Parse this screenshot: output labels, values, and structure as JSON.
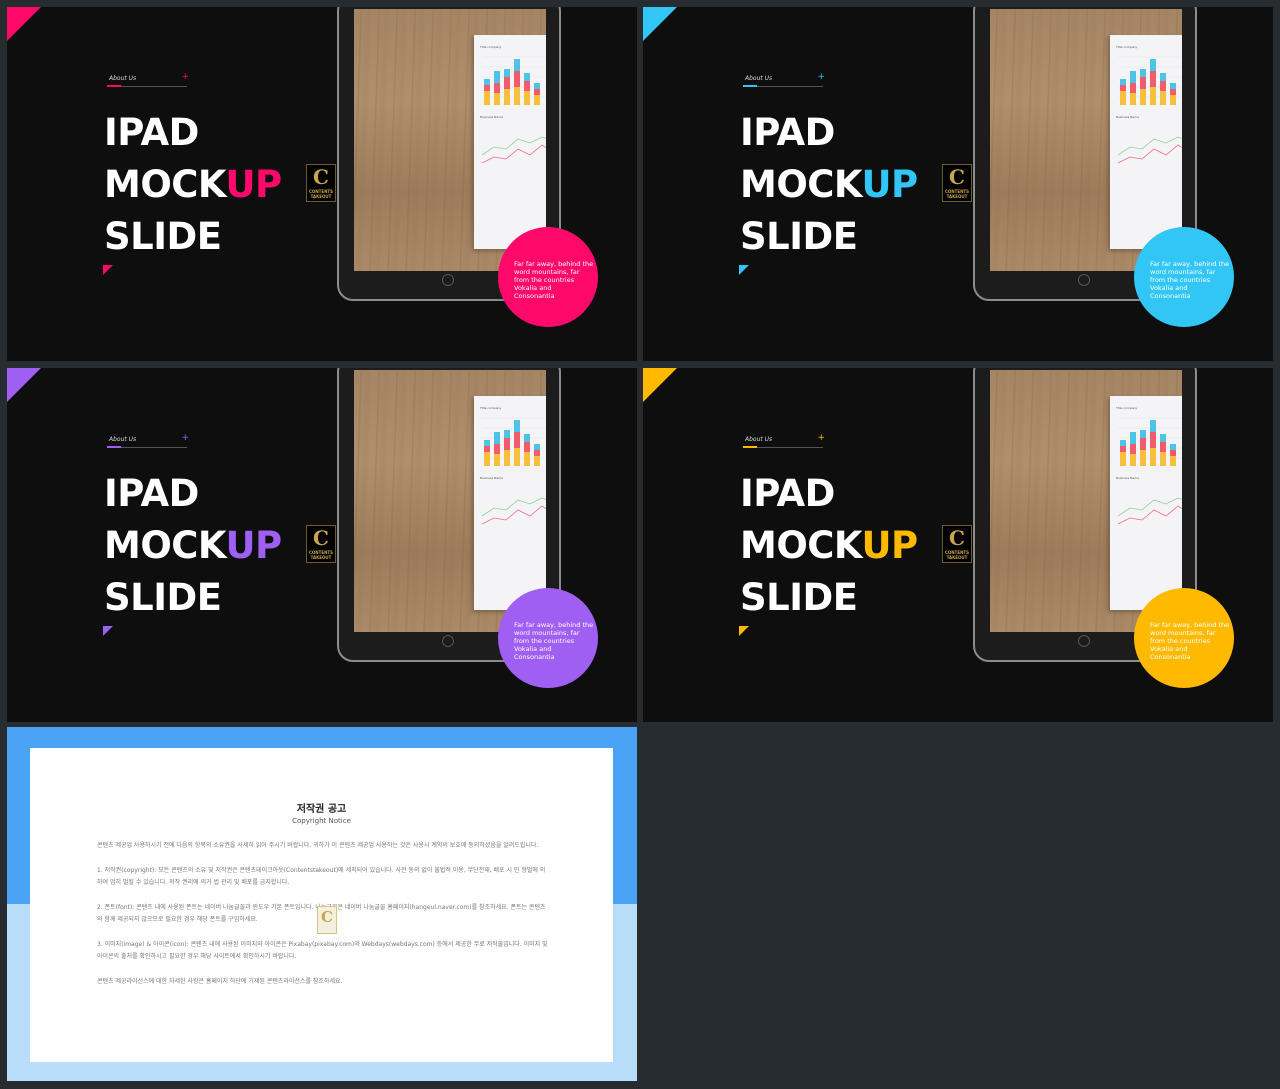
{
  "slides": [
    {
      "accent": "#ff0a6b",
      "about_label": "About Us",
      "plus": "+",
      "title_line1": "IPAD",
      "title_line2_a": "MOCK",
      "title_line2_b": "UP",
      "title_line3": "SLIDE",
      "logo_letter": "C",
      "logo_text": "CONTENTS TAKEOUT",
      "paper_title_1": "Title company",
      "paper_title_2": "Business Name",
      "circle_text": "Far far away, behind the word mountains, far from the countries Vokalia and Consonantia"
    },
    {
      "accent": "#31c6f5",
      "about_label": "About Us",
      "plus": "+",
      "title_line1": "IPAD",
      "title_line2_a": "MOCK",
      "title_line2_b": "UP",
      "title_line3": "SLIDE",
      "logo_letter": "C",
      "logo_text": "CONTENTS TAKEOUT",
      "paper_title_1": "Title company",
      "paper_title_2": "Business Name",
      "circle_text": "Far far away, behind the word mountains, far from the countries Vokalia and Consonantia"
    },
    {
      "accent": "#a05ff3",
      "about_label": "About Us",
      "plus": "+",
      "title_line1": "IPAD",
      "title_line2_a": "MOCK",
      "title_line2_b": "UP",
      "title_line3": "SLIDE",
      "logo_letter": "C",
      "logo_text": "CONTENTS TAKEOUT",
      "paper_title_1": "Title company",
      "paper_title_2": "Business Name",
      "circle_text": "Far far away, behind the word mountains, far from the countries Vokalia and Consonantia"
    },
    {
      "accent": "#ffba00",
      "about_label": "About Us",
      "plus": "+",
      "title_line1": "IPAD",
      "title_line2_a": "MOCK",
      "title_line2_b": "UP",
      "title_line3": "SLIDE",
      "logo_letter": "C",
      "logo_text": "CONTENTS TAKEOUT",
      "paper_title_1": "Title company",
      "paper_title_2": "Business Name",
      "circle_text": "Far far away, behind the word mountains, far from the countries Vokalia and Consonantia"
    }
  ],
  "notice": {
    "title": "저작권 공고",
    "subtitle": "Copyright Notice",
    "logo_letter": "C",
    "paragraphs": [
      "콘텐츠 제공업 사용하시기 전에 다음의 항목의 소유권을 사세히 읽어 주시기 바랍니다. 귀하가 이 콘텐츠 제공업 사용하는 것은 사용시 계약의 보호에 동의하셨음을 알려드립니다.",
      "1. 저작권(copyright): 모든 콘텐츠의 소유 및 저작권은 콘텐츠테이크아웃(Contentstakeout)에 세칙되어 있습니다. 사전 동의 없이 불법적 이용, 무단전재, 배포 시 민 형벌에 의하여 엄히 벌될 수 있습니다. 저작 권리에 의거 법 관리 및 배포를 금지합니다.",
      "2. 폰트(font): 콘텐츠 내에 사용된 폰트는 네이버 나눔글꼴과 윈도우 기본 폰트입니다. 나눔글꼴은 네이버 나눔글꼴 홈페이지(hangeul.naver.com)를 참조하세요. 폰트는 콘텐츠와 함께 제공되지 않으므로 필요한 경우 해당 폰트를 구입하세요.",
      "3. 이미지(image) & 아이콘(icon): 콘텐츠 내에 사용된 이미지와 아이콘은 Pixabay(pixabay.com)와 Webdays(webdays.com) 등에서 제공한 무료 저작물입니다. 이미지 및 아이콘의 출처를 확인하시고 필요한 경우 해당 사이트에서 확인하시기 바랍니다.",
      "콘텐츠 제공라이선스에 대한 자세한 사항은 홈페이지 하단에 기재된 콘텐츠라이선스를 참조하세요."
    ]
  }
}
